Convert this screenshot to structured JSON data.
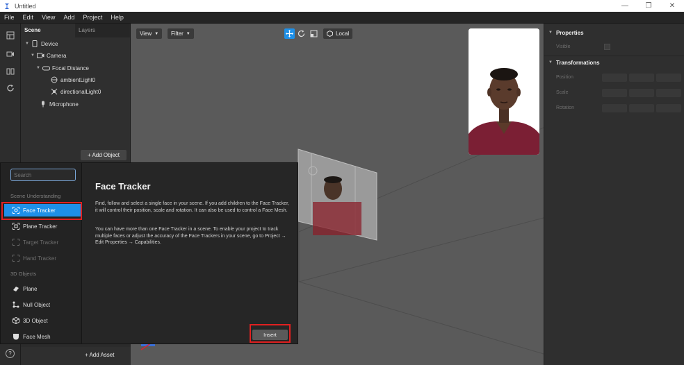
{
  "window": {
    "title": "Untitled",
    "controls": {
      "minimize": "—",
      "maximize": "❐",
      "close": "✕"
    }
  },
  "menu": [
    "File",
    "Edit",
    "View",
    "Add",
    "Project",
    "Help"
  ],
  "scene_panel": {
    "tabs": [
      "Scene",
      "Layers"
    ],
    "tree": [
      {
        "label": "Device",
        "icon": "phone-icon"
      },
      {
        "label": "Camera",
        "icon": "camera-icon"
      },
      {
        "label": "Focal Distance",
        "icon": "focal-distance-icon"
      },
      {
        "label": "ambientLight0",
        "icon": "light-icon"
      },
      {
        "label": "directionalLight0",
        "icon": "sun-icon"
      },
      {
        "label": "Microphone",
        "icon": "microphone-icon"
      }
    ],
    "add_object_label": "+ Add Object"
  },
  "viewport": {
    "view_label": "View",
    "filter_label": "Filter",
    "space_label": "Local",
    "active_tool_color": "#1e90e8"
  },
  "properties": {
    "title": "Properties",
    "visible_label": "Visible",
    "transformations_title": "Transformations",
    "rows": [
      "Position",
      "Scale",
      "Rotation"
    ]
  },
  "assets": {
    "add_asset_label": "+ Add Asset"
  },
  "help_label": "?",
  "insert_dialog": {
    "search_placeholder": "Search",
    "categories": [
      {
        "label": "Scene Understanding",
        "items": [
          {
            "label": "Face Tracker",
            "icon": "face-tracker-icon",
            "state": "selected"
          },
          {
            "label": "Plane Tracker",
            "icon": "plane-tracker-icon",
            "state": "enabled"
          },
          {
            "label": "Target Tracker",
            "icon": "target-tracker-icon",
            "state": "disabled"
          },
          {
            "label": "Hand Tracker",
            "icon": "hand-tracker-icon",
            "state": "disabled"
          }
        ]
      },
      {
        "label": "3D Objects",
        "items": [
          {
            "label": "Plane",
            "icon": "plane-icon",
            "state": "enabled"
          },
          {
            "label": "Null Object",
            "icon": "null-object-icon",
            "state": "enabled"
          },
          {
            "label": "3D Object",
            "icon": "cube-icon",
            "state": "enabled"
          },
          {
            "label": "Face Mesh",
            "icon": "face-mesh-icon",
            "state": "enabled"
          }
        ]
      }
    ],
    "detail": {
      "title": "Face Tracker",
      "paragraph1": "Find, follow and select a single face in your scene. If you add children to the Face Tracker, it will control their position, scale and rotation. It can also be used to control a Face Mesh.",
      "paragraph2": "You can have more than one Face Tracker in a scene. To enable your project to track multiple faces or adjust the accuracy of the Face Trackers in your scene, go to Project → Edit Properties → Capabilities.",
      "insert_label": "Insert"
    },
    "highlight_color": "#e02020"
  }
}
